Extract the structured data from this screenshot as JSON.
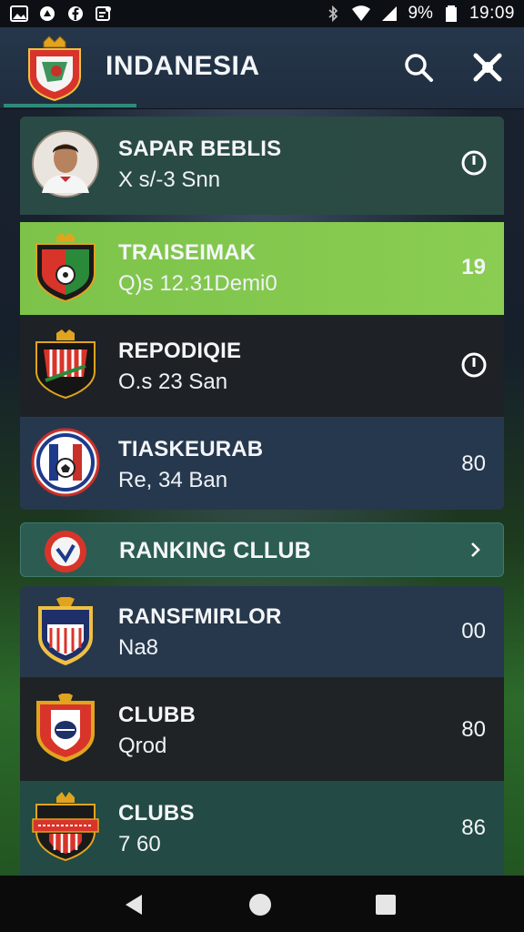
{
  "status_bar": {
    "battery": "9%",
    "time": "19:09",
    "left_icons": [
      "image-icon",
      "app-icon",
      "facebook-icon",
      "notification-icon"
    ],
    "right_icons": [
      "bluetooth-icon",
      "wifi-icon",
      "signal-icon",
      "battery-icon"
    ]
  },
  "app_bar": {
    "title": "INDANESIA",
    "search_icon": "search-icon",
    "close_icon": "close-icon"
  },
  "rows": [
    {
      "name": "SAPAR BEBLIS",
      "sub": "X s/-3 Snn",
      "trail_icon": "clock-icon",
      "type": "player"
    },
    {
      "name": "TRAISEIMAK",
      "sub": "Q)s 12.31Demi0",
      "trail": "19",
      "type": "club"
    },
    {
      "name": "REPODIQIE",
      "sub": "O.s 23 San",
      "trail_icon": "clock-icon",
      "type": "club"
    },
    {
      "name": "TIASKEURAB",
      "sub": "Re, 34 Ban",
      "trail": "80",
      "type": "club"
    },
    {
      "name": "RANKING  CLLUB",
      "trail_icon": "chevron-right-icon",
      "type": "section"
    },
    {
      "name": "RANSFMIRLOR",
      "sub": "Na8",
      "trail": "00",
      "type": "club"
    },
    {
      "name": "CLUBB",
      "sub": "Qrod",
      "trail": "80",
      "type": "club"
    },
    {
      "name": "CLUBS",
      "sub": "7 60",
      "trail": "86",
      "type": "club"
    }
  ],
  "colors": {
    "highlight_row": "#8acd52",
    "accent_tab": "#2f8a7a",
    "app_bar": "#26374b"
  },
  "nav_bar": [
    "back-icon",
    "home-icon",
    "recents-icon"
  ]
}
